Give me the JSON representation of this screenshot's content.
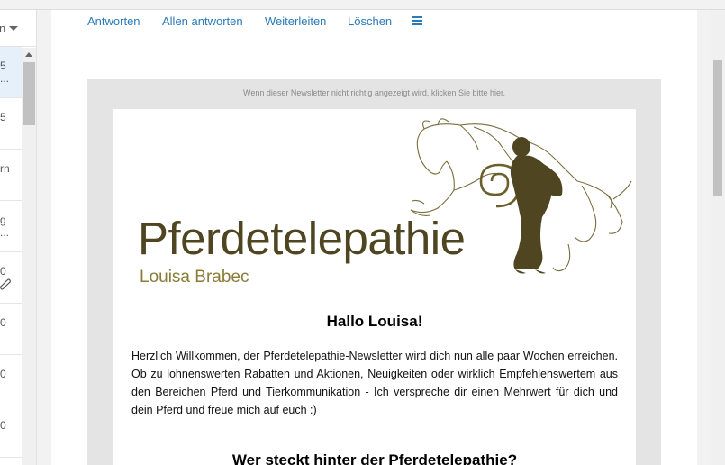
{
  "list": {
    "header_text": "n",
    "rows": [
      {
        "top": "5",
        "sub": "...",
        "selected": true
      },
      {
        "top": "5",
        "sub": ""
      },
      {
        "top": "rn",
        "sub": ""
      },
      {
        "top": "g",
        "sub": "..."
      },
      {
        "top": "0",
        "sub": "",
        "attachment": true
      },
      {
        "top": "0",
        "sub": ""
      },
      {
        "top": "0",
        "sub": ""
      },
      {
        "top": "0",
        "sub": ""
      }
    ]
  },
  "toolbar": {
    "reply_label": "Antworten",
    "reply_all_label": "Allen antworten",
    "forward_label": "Weiterleiten",
    "delete_label": "Löschen"
  },
  "newsletter": {
    "view_online_text": "Wenn dieser Newsletter nicht richtig angezeigt wird, klicken Sie bitte hier.",
    "logo_title": "Pferdetelepathie",
    "logo_subtitle": "Louisa Brabec",
    "greeting": "Hallo Louisa!",
    "intro": "Herzlich Willkommen, der Pferdetelepathie-Newsletter wird dich nun alle paar Wochen erreichen. Ob zu lohnenswerten Rabatten und Aktionen, Neuigkeiten oder wirklich Empfehlenswertem aus den Bereichen Pferd und Tierkommunikation - Ich verspreche dir einen Mehrwert für dich und dein Pferd und freue mich auf euch :)",
    "subheading": "Wer steckt hinter der Pferdetelepathie?"
  },
  "colors": {
    "link": "#2a7ab8",
    "logo_dark": "#4f4521",
    "logo_gold": "#8a7c38",
    "newsletter_frame": "#e4e4e4"
  },
  "icons": [
    "chevron-down-icon",
    "scroll-up-arrow-icon",
    "paperclip-icon",
    "hamburger-menu-icon",
    "horse-woman-logo-icon"
  ]
}
